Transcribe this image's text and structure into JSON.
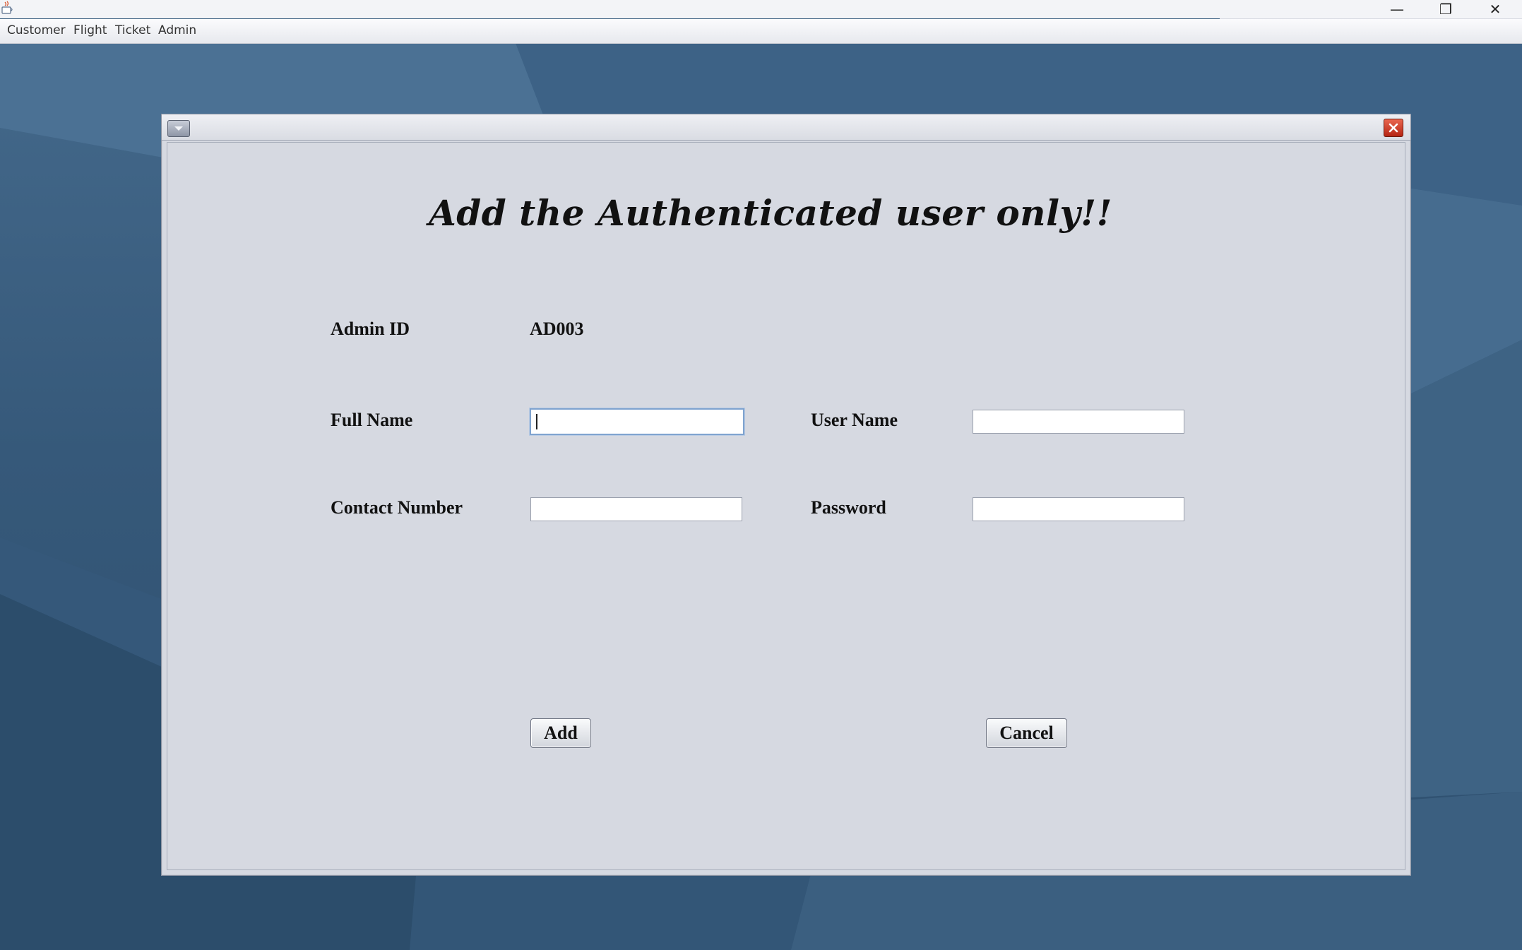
{
  "window": {
    "minimize_glyph": "—",
    "maximize_glyph": "❐",
    "close_glyph": "✕"
  },
  "menubar": {
    "items": [
      {
        "label": "Customer"
      },
      {
        "label": "Flight"
      },
      {
        "label": "Ticket"
      },
      {
        "label": "Admin"
      }
    ]
  },
  "dialog": {
    "heading": "Add the Authenticated user only!!",
    "admin_id_label": "Admin ID",
    "admin_id_value": "AD003",
    "full_name_label": "Full Name",
    "full_name_value": "",
    "user_name_label": "User Name",
    "user_name_value": "",
    "contact_number_label": "Contact Number",
    "contact_number_value": "",
    "password_label": "Password",
    "password_value": "",
    "add_button": "Add",
    "cancel_button": "Cancel"
  },
  "colors": {
    "desktop": "#3a5f80",
    "dialog_bg": "#d6d9e1",
    "close_button": "#c83a24"
  },
  "icons": {
    "app_icon": "java-coffee-icon",
    "system_menu": "chevron-down-icon",
    "frame_close": "close-icon"
  }
}
